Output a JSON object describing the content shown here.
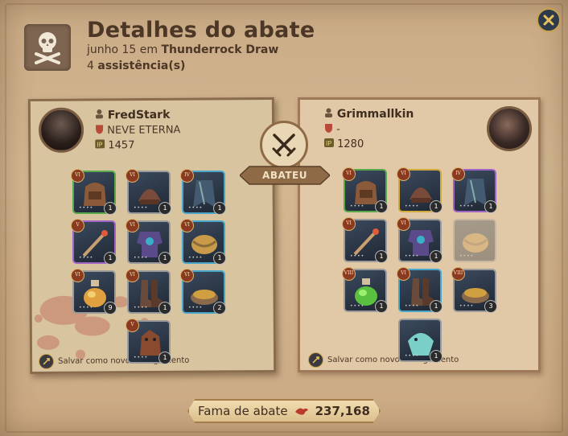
{
  "header": {
    "title": "Detalhes do abate",
    "date": "junho 15 em",
    "location": "Thunderrock Draw",
    "assist_count": "4",
    "assist_label": "assistência(s)"
  },
  "killer": {
    "name": "FredStark",
    "guild": "NEVE ETERNA",
    "ip": "1457",
    "save_label": "Salvar como novo carregamento",
    "items": [
      {
        "slot": "bag",
        "tier": "VI",
        "qty": "1",
        "rarity": "green"
      },
      {
        "slot": "head",
        "tier": "VI",
        "qty": "1",
        "rarity": "gray"
      },
      {
        "slot": "cape",
        "tier": "IV",
        "qty": "1",
        "rarity": "blue"
      },
      {
        "slot": "weapon",
        "tier": "V",
        "qty": "1",
        "rarity": "purple"
      },
      {
        "slot": "armor",
        "tier": "VI",
        "qty": "1",
        "rarity": "gray"
      },
      {
        "slot": "offhand",
        "tier": "VI",
        "qty": "1",
        "rarity": "blue"
      },
      {
        "slot": "potion",
        "tier": "VI",
        "qty": "9",
        "rarity": "gray"
      },
      {
        "slot": "shoes",
        "tier": "VI",
        "qty": "1",
        "rarity": "gray"
      },
      {
        "slot": "food",
        "tier": "VI",
        "qty": "2",
        "rarity": "blue"
      },
      {
        "slot": "mount",
        "tier": "V",
        "qty": "1",
        "rarity": "gray"
      }
    ]
  },
  "victim": {
    "name": "Grimmallkin",
    "guild": "-",
    "ip": "1280",
    "save_label": "Salvar como novo carregamento",
    "items": [
      {
        "slot": "bag",
        "tier": "VI",
        "qty": "1",
        "rarity": "green"
      },
      {
        "slot": "head",
        "tier": "VI",
        "qty": "1",
        "rarity": "gold"
      },
      {
        "slot": "cape",
        "tier": "IV",
        "qty": "1",
        "rarity": "purple"
      },
      {
        "slot": "weapon",
        "tier": "VI",
        "qty": "1",
        "rarity": "gray"
      },
      {
        "slot": "armor",
        "tier": "VI",
        "qty": "1",
        "rarity": "gray"
      },
      {
        "slot": "offhand",
        "tier": "",
        "qty": "",
        "rarity": "ghost"
      },
      {
        "slot": "potion",
        "tier": "VIII",
        "qty": "1",
        "rarity": "gray"
      },
      {
        "slot": "shoes",
        "tier": "VI",
        "qty": "1",
        "rarity": "blue"
      },
      {
        "slot": "food",
        "tier": "VIII",
        "qty": "3",
        "rarity": "gray"
      },
      {
        "slot": "mount",
        "tier": "",
        "qty": "1",
        "rarity": "gray"
      }
    ]
  },
  "center_label": "ABATEU",
  "fame": {
    "label": "Fama de abate",
    "value": "237,168"
  },
  "colors": {
    "accent_gold": "#c9a24a",
    "text_brown": "#4c3626",
    "blood": "#b84a3a"
  }
}
